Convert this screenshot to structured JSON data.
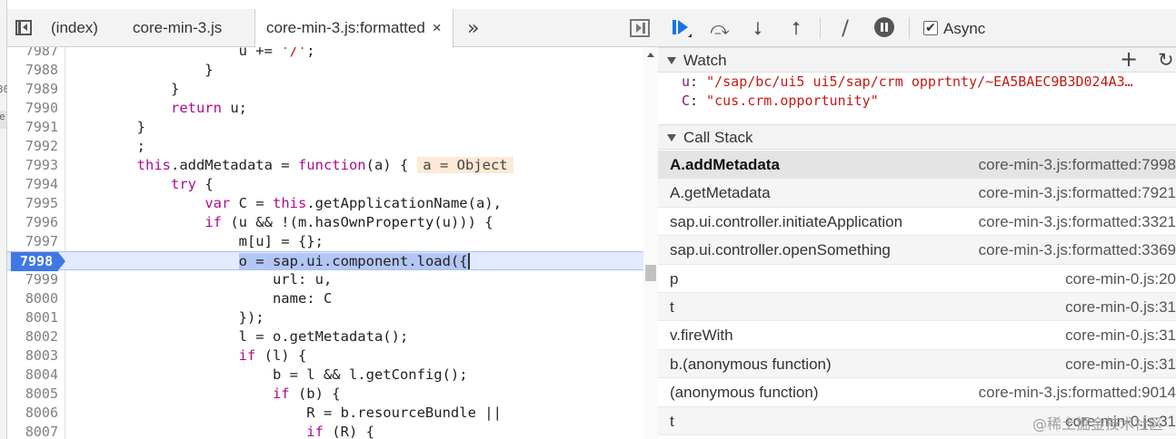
{
  "left_strip": {
    "frag1": "30",
    "frag2": "e"
  },
  "source_panel": {
    "tabs": [
      {
        "label": "(index)"
      },
      {
        "label": "core-min-3.js"
      },
      {
        "label": "core-min-3.js:formatted",
        "close": "×"
      }
    ],
    "more_tabs_glyph": "»",
    "code_lines": [
      {
        "ln": "7987",
        "text": "                    u += '/';"
      },
      {
        "ln": "7988",
        "text": "                }"
      },
      {
        "ln": "7989",
        "text": "            }"
      },
      {
        "ln": "7990",
        "text": "            return u;"
      },
      {
        "ln": "7991",
        "text": "        }"
      },
      {
        "ln": "7992",
        "text": "        ;"
      },
      {
        "ln": "7993",
        "text": "        this.addMetadata = function(a) {",
        "inline": "a = Object"
      },
      {
        "ln": "7994",
        "text": "            try {"
      },
      {
        "ln": "7995",
        "text": "                var C = this.getApplicationName(a),"
      },
      {
        "ln": "7996",
        "text": "                if (u && !(m.hasOwnProperty(u))) {"
      },
      {
        "ln": "7997",
        "text": "                    m[u] = {};"
      },
      {
        "ln": "7998",
        "text": "o = sap.ui.component.load({",
        "indent": "                    ",
        "exec": true
      },
      {
        "ln": "7999",
        "text": "                        url: u,"
      },
      {
        "ln": "8000",
        "text": "                        name: C"
      },
      {
        "ln": "8001",
        "text": "                    });"
      },
      {
        "ln": "8002",
        "text": "                    l = o.getMetadata();"
      },
      {
        "ln": "8003",
        "text": "                    if (l) {"
      },
      {
        "ln": "8004",
        "text": "                        b = l && l.getConfig();"
      },
      {
        "ln": "8005",
        "text": "                        if (b) {"
      },
      {
        "ln": "8006",
        "text": "                            R = b.resourceBundle ||"
      },
      {
        "ln": "8007",
        "text": "                            if (R) {"
      }
    ]
  },
  "debugger": {
    "toolbar": {
      "step_over_glyph": "⤼",
      "step_into_glyph": "⭣",
      "step_out_glyph": "⭡",
      "deactivate_glyph": "⧸",
      "async_checked": "✔",
      "async_label": "Async"
    },
    "watch": {
      "title": "Watch",
      "add_glyph": "+",
      "refresh_glyph": "↻",
      "items": [
        {
          "name": "u",
          "sep": ": ",
          "value": "\"/sap/bc/ui5 ui5/sap/crm opprtnty/~EA5BAEC9B3D024A3…"
        },
        {
          "name": "C",
          "sep": ": ",
          "value": "\"cus.crm.opportunity\""
        }
      ]
    },
    "call_stack": {
      "title": "Call Stack",
      "frames": [
        {
          "fn": "A.addMetadata",
          "loc": "core-min-3.js:formatted:7998",
          "selected": true
        },
        {
          "fn": "A.getMetadata",
          "loc": "core-min-3.js:formatted:7921"
        },
        {
          "fn": "sap.ui.controller.initiateApplication",
          "loc": "core-min-3.js:formatted:3321"
        },
        {
          "fn": "sap.ui.controller.openSomething",
          "loc": "core-min-3.js:formatted:3369"
        },
        {
          "fn": "p",
          "loc": "core-min-0.js:20"
        },
        {
          "fn": "t",
          "loc": "core-min-0.js:31"
        },
        {
          "fn": "v.fireWith",
          "loc": "core-min-0.js:31"
        },
        {
          "fn": "b.(anonymous function)",
          "loc": "core-min-0.js:31"
        },
        {
          "fn": "(anonymous function)",
          "loc": "core-min-3.js:formatted:9014"
        },
        {
          "fn": "t",
          "loc": "core-min-0.js:31"
        }
      ]
    }
  },
  "watermark": "@稀土掘金技术社区"
}
